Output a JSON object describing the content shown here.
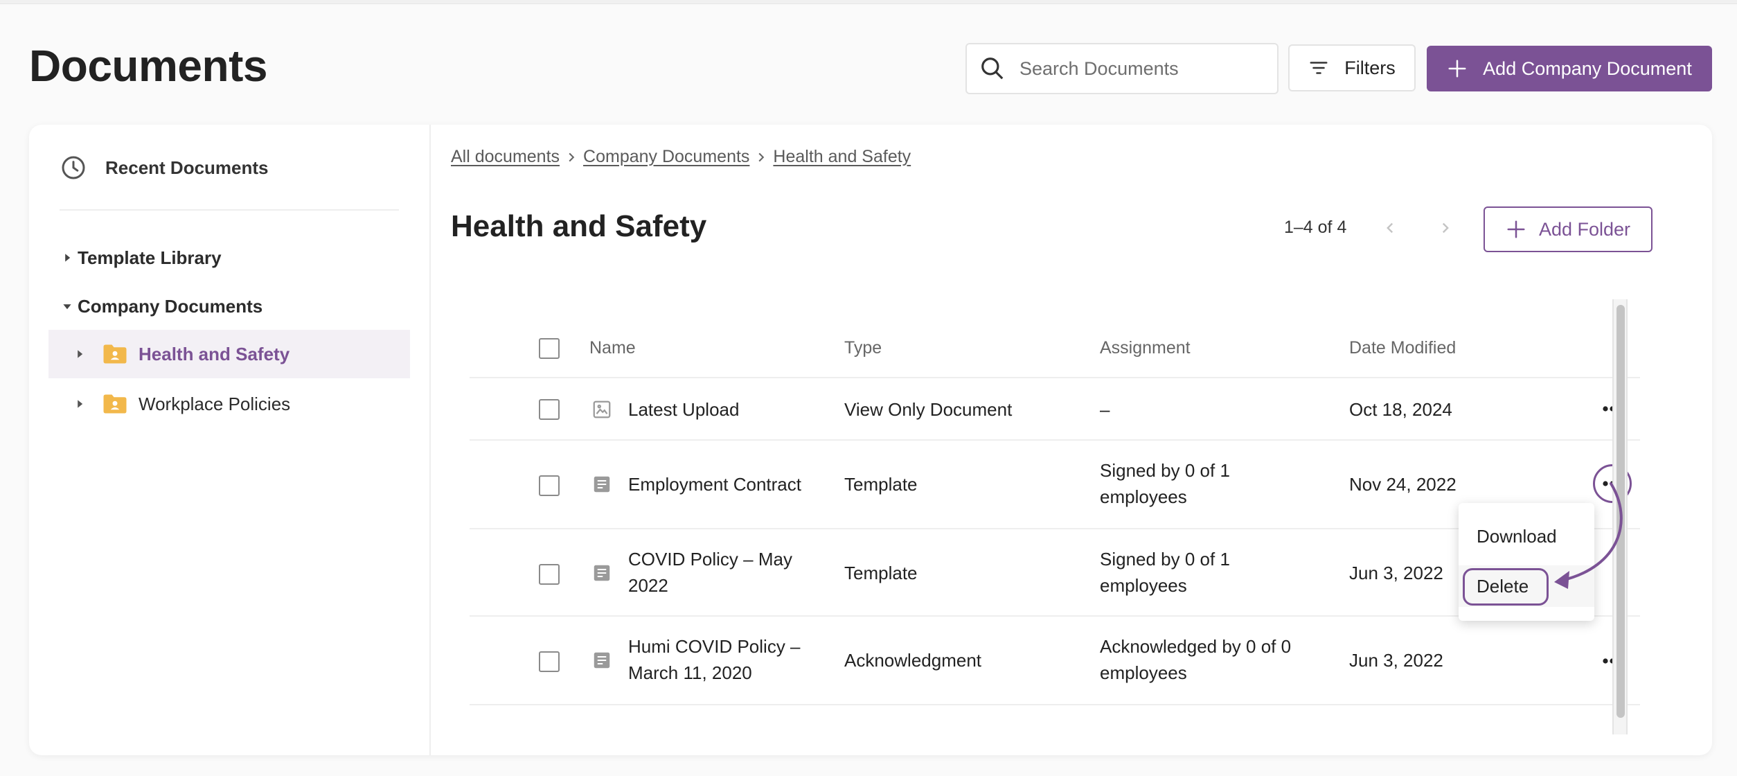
{
  "page": {
    "title": "Documents"
  },
  "search": {
    "placeholder": "Search Documents",
    "value": ""
  },
  "toolbar": {
    "filters_label": "Filters",
    "add_document_label": "Add Company Document"
  },
  "sidebar": {
    "recent_label": "Recent Documents",
    "tree": [
      {
        "label": "Template Library",
        "expanded": false
      },
      {
        "label": "Company Documents",
        "expanded": true
      }
    ],
    "folders": [
      {
        "label": "Health and Safety",
        "active": true
      },
      {
        "label": "Workplace Policies",
        "active": false
      }
    ]
  },
  "breadcrumb": [
    "All documents",
    "Company Documents",
    "Health and Safety"
  ],
  "main": {
    "folder_title": "Health and Safety",
    "pagination": "1–4 of 4",
    "add_folder_label": "Add Folder"
  },
  "table": {
    "columns": [
      "Name",
      "Type",
      "Assignment",
      "Date Modified"
    ],
    "rows": [
      {
        "name": "Latest Upload",
        "type": "View Only Document",
        "assignment": "–",
        "date": "Oct 18, 2024",
        "icon": "image-icon"
      },
      {
        "name": "Employment Contract",
        "type": "Template",
        "assignment": "Signed by 0 of 1 employees",
        "date": "Nov 24, 2022",
        "icon": "document-icon"
      },
      {
        "name": "COVID Policy – May 2022",
        "type": "Template",
        "assignment": "Signed by 0 of 1 employees",
        "date": "Jun 3, 2022",
        "icon": "document-icon"
      },
      {
        "name": "Humi COVID Policy – March 11, 2020",
        "type": "Acknowledgment",
        "assignment": "Acknowledged by 0 of 0 employees",
        "date": "Jun 3, 2022",
        "icon": "document-icon"
      }
    ]
  },
  "context_menu": {
    "items": [
      "Download",
      "Delete"
    ]
  },
  "colors": {
    "accent": "#7b5295",
    "folder": "#f2b84b",
    "active_bg": "#f3f0f5"
  }
}
